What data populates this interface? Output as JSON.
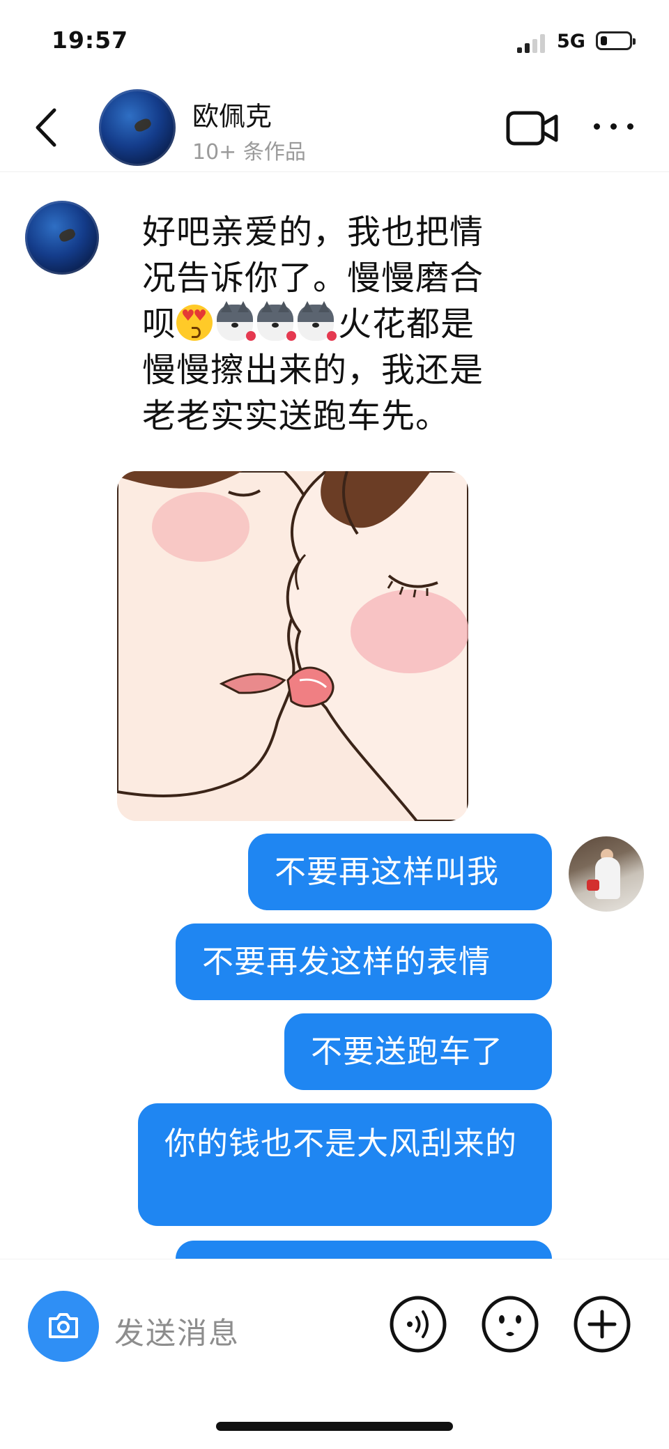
{
  "status_bar": {
    "time": "19:57",
    "network": "5G",
    "battery_level": 0.25
  },
  "header": {
    "contact_name": "欧佩克",
    "contact_subtitle": "10+ 条作品",
    "avatar": "contact-avatar-dark-blue",
    "icons": [
      "back-chevron-icon",
      "video-call-icon",
      "more-icon"
    ]
  },
  "messages": {
    "incoming": {
      "line1": "好吧亲爱的，我也把情",
      "line2": "况告诉你了。慢慢磨合",
      "line3_text": "呗",
      "line3_emojis": [
        "smiling-face-heart-eyes-emoji",
        "husky-dog-emoji",
        "husky-dog-emoji",
        "husky-dog-emoji"
      ],
      "line3_tail": "火花都是",
      "line4": "慢慢擦出来的，我还是",
      "line5": "老老实实送跑车先。",
      "sticker": "kissing-couple-illustration-sticker"
    },
    "outgoing": [
      "不要再这样叫我",
      "不要再发这样的表情",
      "不要送跑车了",
      "你的钱也不是大风刮来的"
    ],
    "outgoing_partial_bubble": ""
  },
  "composer": {
    "placeholder": "发送消息",
    "icons": [
      "camera-icon",
      "voice-icon",
      "emoji-icon",
      "plus-icon"
    ]
  },
  "colors": {
    "bubble_blue": "#1f86f2",
    "camera_blue": "#2f8ff5",
    "subtitle_gray": "#9a9a9a"
  }
}
